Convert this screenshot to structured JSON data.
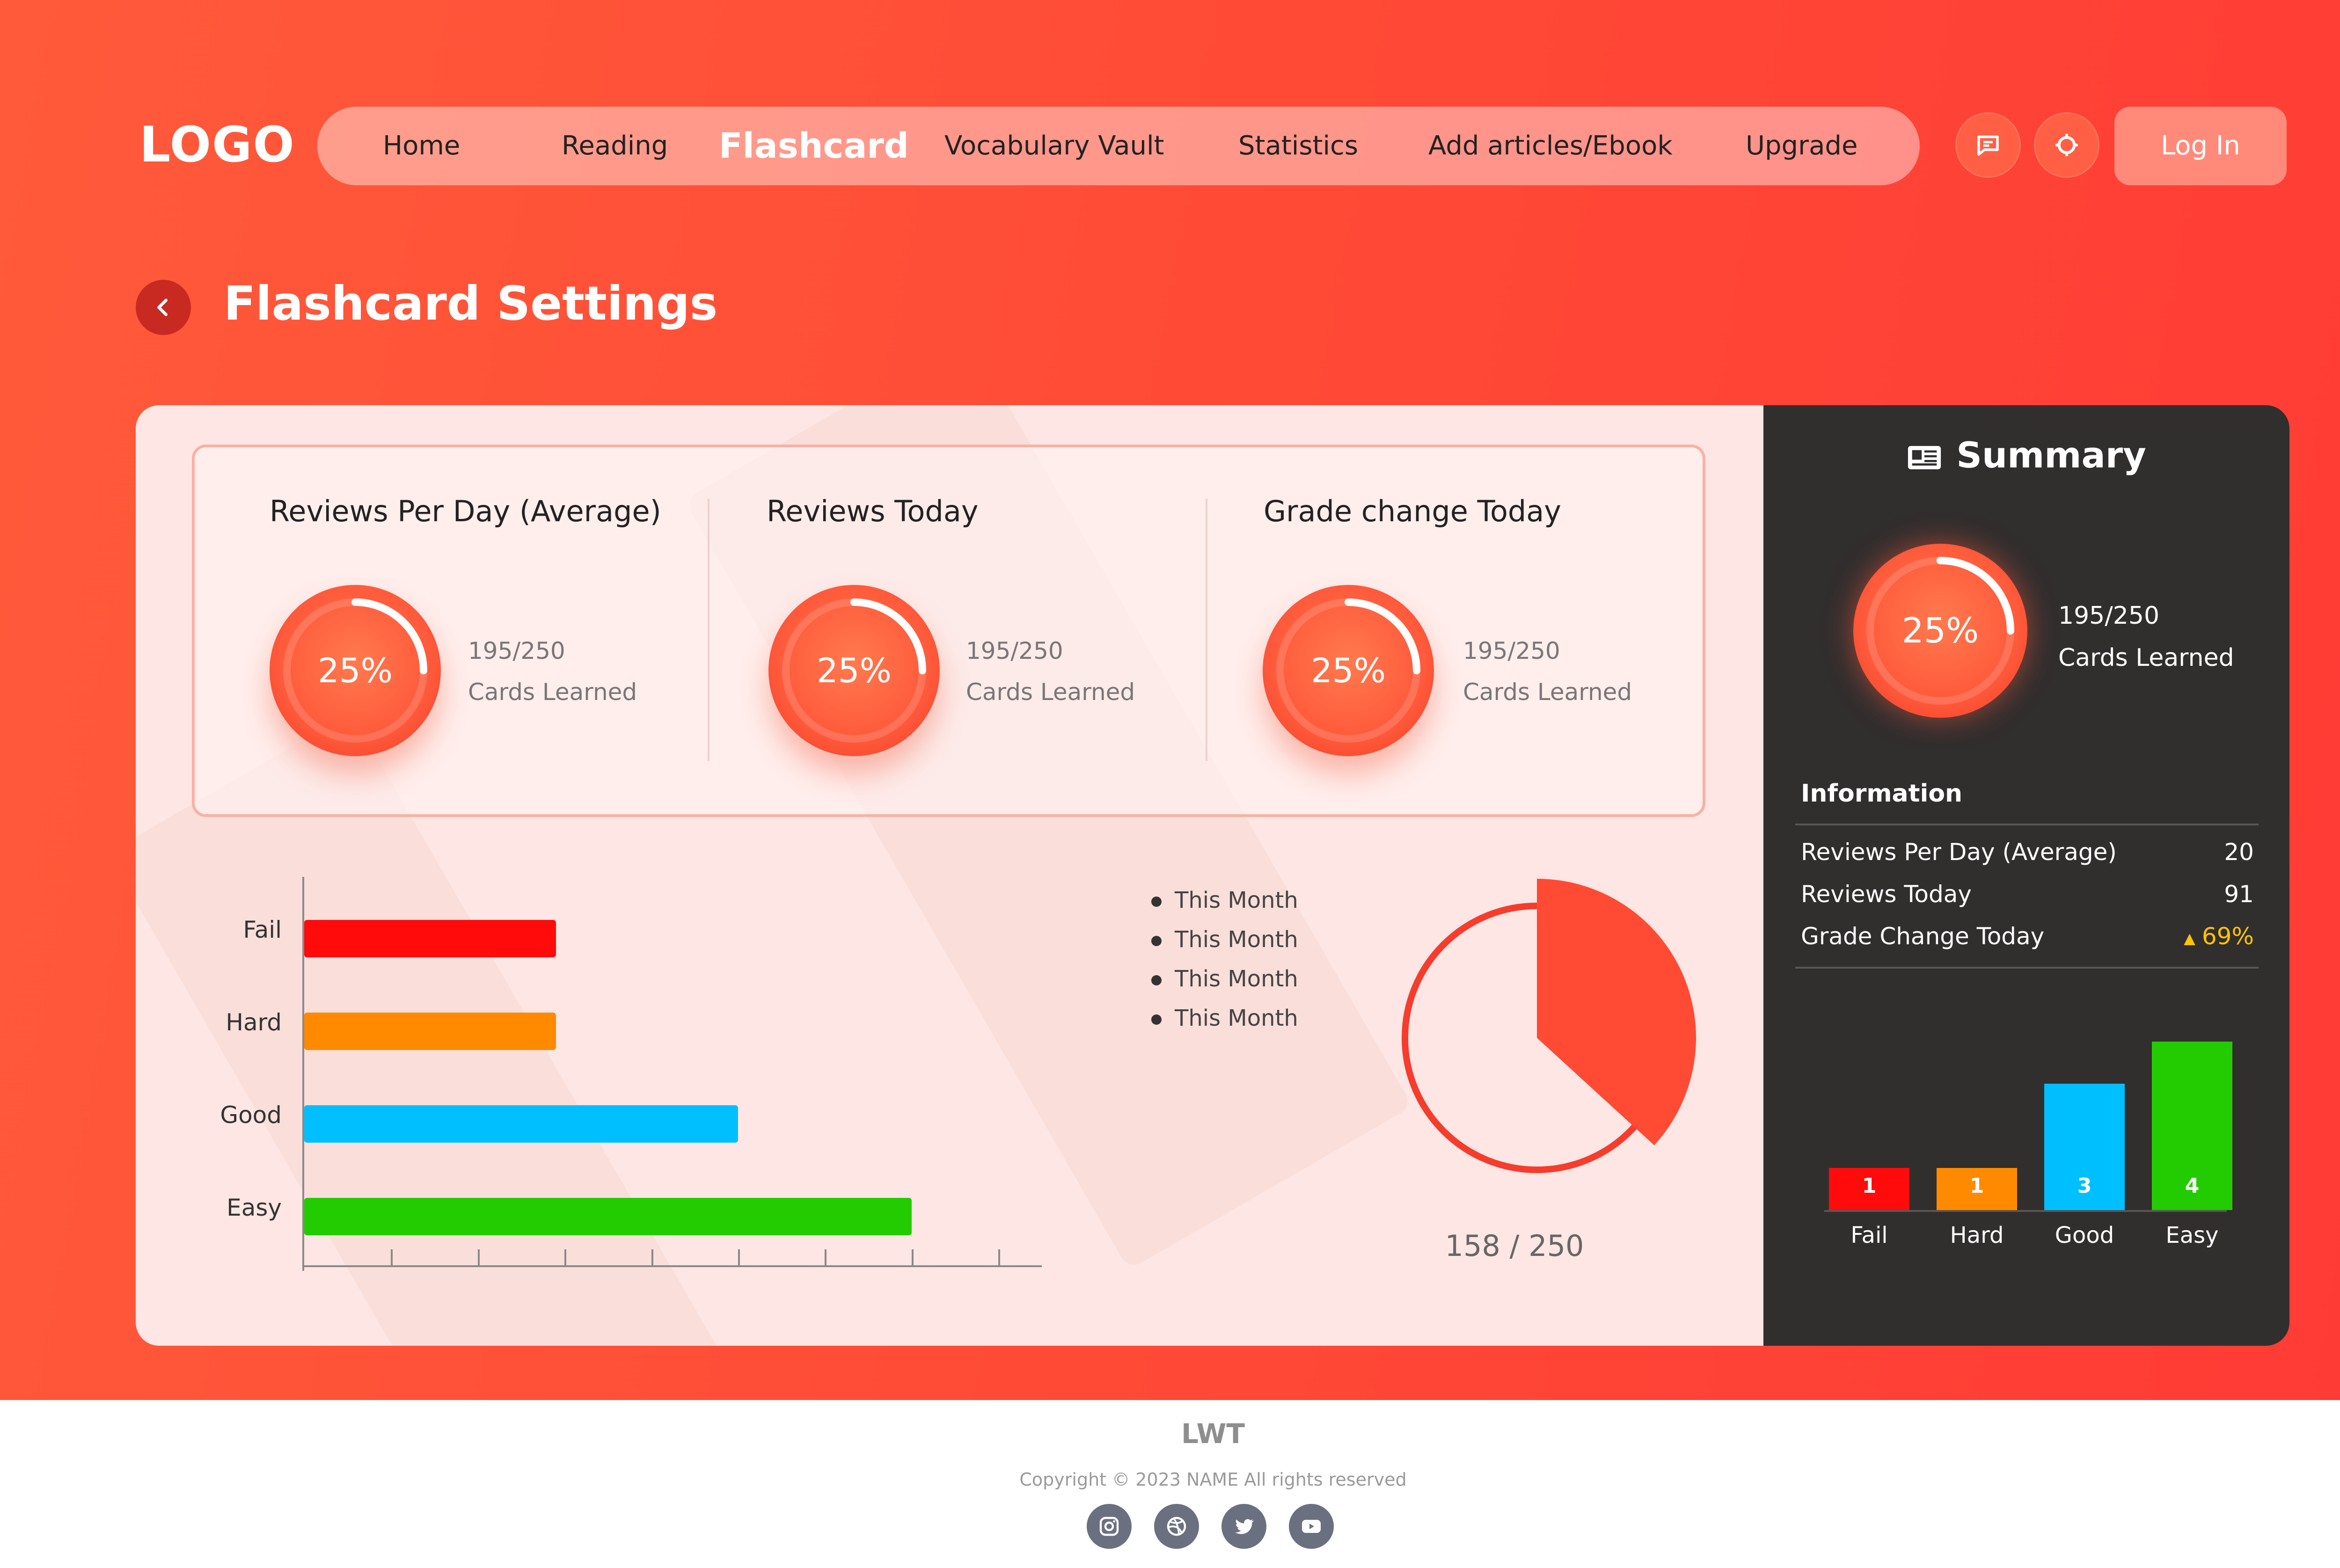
{
  "logo": "LOGO",
  "nav": {
    "items": [
      {
        "label": "Home"
      },
      {
        "label": "Reading"
      },
      {
        "label": "Flashcard"
      },
      {
        "label": "Vocabulary Vault"
      },
      {
        "label": "Statistics"
      },
      {
        "label": "Add articles/Ebook"
      },
      {
        "label": "Upgrade"
      }
    ],
    "active": "Flashcard",
    "icons": [
      "chat-icon",
      "settings-icon"
    ],
    "login_label": "Log In"
  },
  "page": {
    "title": "Flashcard Settings"
  },
  "stats": [
    {
      "title": "Reviews Per Day (Average)",
      "percent": "25%",
      "progress": 0.25,
      "count": "195/250",
      "label": "Cards Learned"
    },
    {
      "title": "Reviews Today",
      "percent": "25%",
      "progress": 0.25,
      "count": "195/250",
      "label": "Cards Learned"
    },
    {
      "title": "Grade change Today",
      "percent": "25%",
      "progress": 0.25,
      "count": "195/250",
      "label": "Cards Learned"
    }
  ],
  "chart_data": [
    {
      "type": "bar",
      "orientation": "horizontal",
      "categories": [
        "Fail",
        "Hard",
        "Good",
        "Easy"
      ],
      "values": [
        2.9,
        2.9,
        5.0,
        7.0
      ],
      "colors": [
        "#ff0b0b",
        "#ff8a00",
        "#00bfff",
        "#22cc00"
      ],
      "xlim": [
        0,
        8.5
      ]
    },
    {
      "type": "pie",
      "legend": [
        "This Month",
        "This Month",
        "This Month",
        "This Month"
      ],
      "values": [
        158
      ],
      "total": 250,
      "label": "158 / 250"
    },
    {
      "type": "bar",
      "categories": [
        "Fail",
        "Hard",
        "Good",
        "Easy"
      ],
      "values": [
        1,
        1,
        3,
        4
      ],
      "value_labels": [
        "1",
        "1",
        "3",
        "4"
      ],
      "colors": [
        "#ff0b0b",
        "#ff8a00",
        "#00bfff",
        "#22cc00"
      ]
    }
  ],
  "summary": {
    "title": "Summary",
    "percent": "25%",
    "progress": 0.25,
    "count": "195/250",
    "label": "Cards Learned",
    "info_title": "Information",
    "info": [
      {
        "label": "Reviews Per Day (Average)",
        "value": "20"
      },
      {
        "label": "Reviews Today",
        "value": "91"
      },
      {
        "label": "Grade Change Today",
        "value": "69%",
        "trend": "up"
      }
    ]
  },
  "footer": {
    "brand": "LWT",
    "copyright": "Copyright © 2023 NAME All rights reserved",
    "social": [
      "instagram-icon",
      "dribbble-icon",
      "twitter-icon",
      "youtube-icon"
    ]
  }
}
